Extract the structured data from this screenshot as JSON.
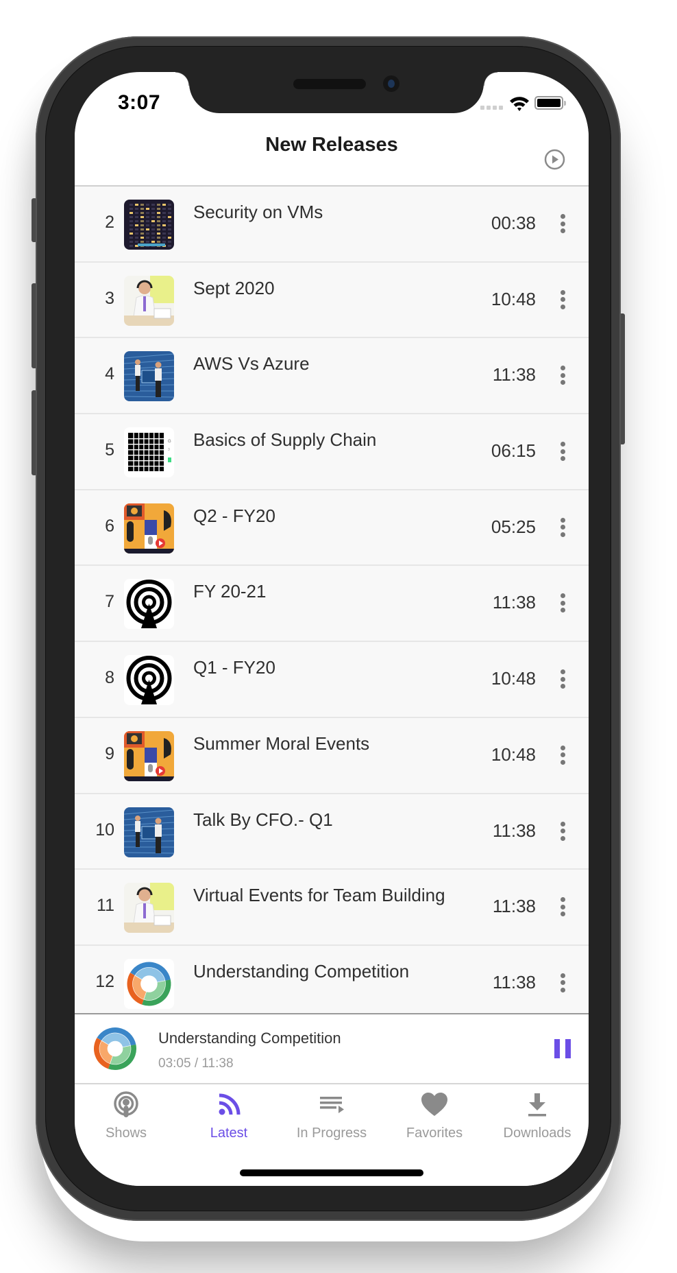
{
  "status_bar": {
    "time": "3:07"
  },
  "header": {
    "title": "New Releases",
    "play_all_icon": "play-circle-icon"
  },
  "episodes": [
    {
      "number": "2",
      "title": "Security on VMs",
      "duration": "00:38",
      "art": "building-night"
    },
    {
      "number": "3",
      "title": "Sept 2020",
      "duration": "10:48",
      "art": "man-headset"
    },
    {
      "number": "4",
      "title": "AWS Vs Azure",
      "duration": "11:38",
      "art": "guards-circuit"
    },
    {
      "number": "5",
      "title": "Basics of Supply Chain",
      "duration": "06:15",
      "art": "grid-chart"
    },
    {
      "number": "6",
      "title": "Q2 - FY20",
      "duration": "05:25",
      "art": "podcast-collage"
    },
    {
      "number": "7",
      "title": "FY 20-21",
      "duration": "11:38",
      "art": "podcast-antenna"
    },
    {
      "number": "8",
      "title": "Q1 - FY20",
      "duration": "10:48",
      "art": "podcast-antenna"
    },
    {
      "number": "9",
      "title": "Summer Moral Events",
      "duration": "10:48",
      "art": "podcast-collage"
    },
    {
      "number": "10",
      "title": "Talk By CFO.- Q1",
      "duration": "11:38",
      "art": "guards-circuit"
    },
    {
      "number": "11",
      "title": "Virtual Events for Team Building",
      "duration": "11:38",
      "art": "man-headset"
    },
    {
      "number": "12",
      "title": "Understanding Competition",
      "duration": "11:38",
      "art": "donut-chart"
    }
  ],
  "now_playing": {
    "title": "Understanding Competition",
    "elapsed": "03:05",
    "total": "11:38",
    "time_display": "03:05 / 11:38",
    "state": "playing"
  },
  "tabs": [
    {
      "label": "Shows",
      "icon": "podcast-icon",
      "active": false
    },
    {
      "label": "Latest",
      "icon": "rss-icon",
      "active": true
    },
    {
      "label": "In Progress",
      "icon": "queue-play-icon",
      "active": false
    },
    {
      "label": "Favorites",
      "icon": "heart-icon",
      "active": false
    },
    {
      "label": "Downloads",
      "icon": "download-icon",
      "active": false
    }
  ],
  "colors": {
    "accent": "#6b4ee6",
    "inactive": "#9a9a9a",
    "list_bg": "#f8f8f8",
    "separator": "#e6e6e6"
  }
}
